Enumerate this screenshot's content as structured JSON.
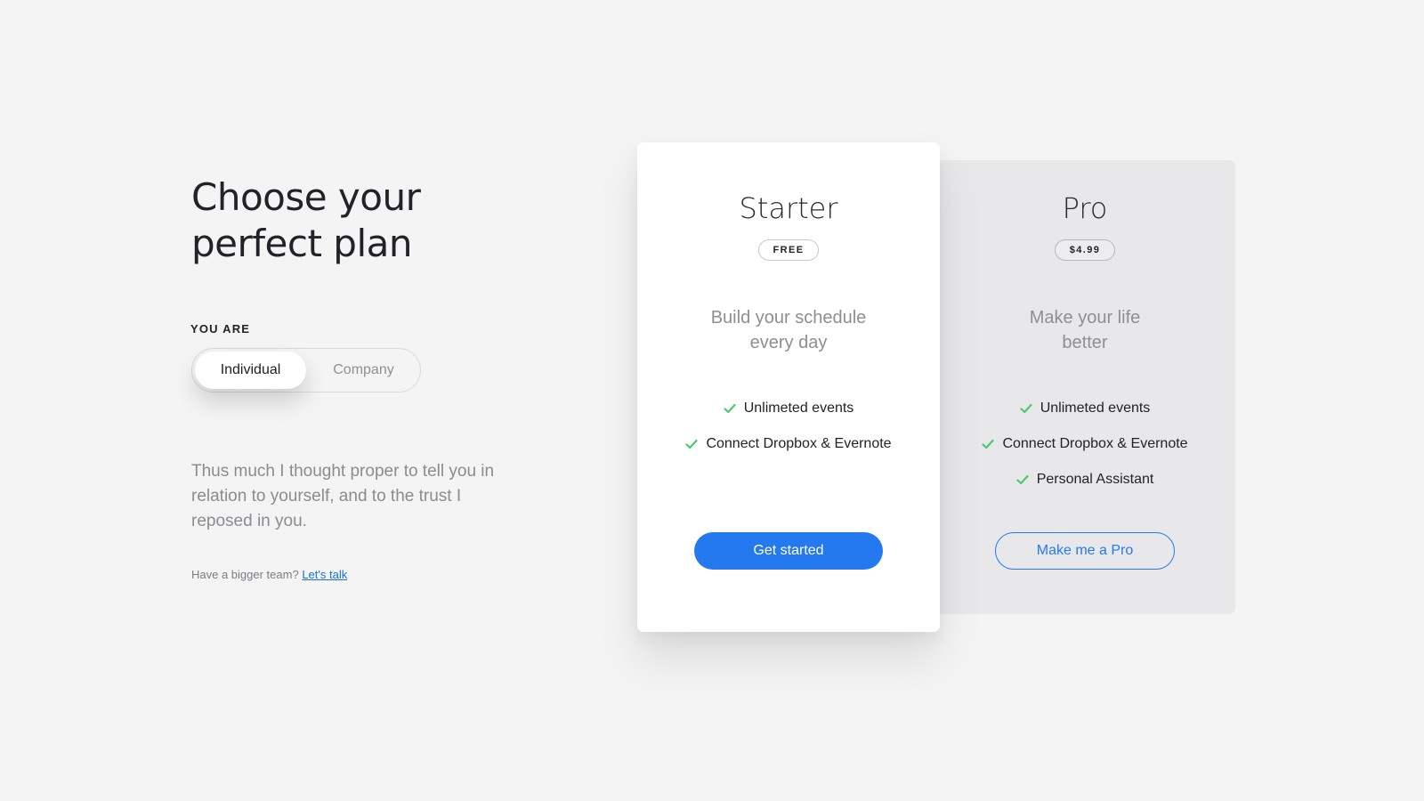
{
  "header": {
    "title_line1": "Choose your",
    "title_line2": "perfect plan"
  },
  "audience": {
    "label": "YOU ARE",
    "options": [
      {
        "label": "Individual",
        "selected": true
      },
      {
        "label": "Company",
        "selected": false
      }
    ]
  },
  "description": "Thus much I thought proper to tell you in relation to yourself, and to the trust I reposed in you.",
  "team": {
    "prompt": "Have a bigger team?",
    "link_label": "Let's talk"
  },
  "plans": [
    {
      "name": "Starter",
      "price": "FREE",
      "tagline": "Build your schedule every day",
      "features": [
        "Unlimeted events",
        "Connect Dropbox & Evernote"
      ],
      "cta": "Get started"
    },
    {
      "name": "Pro",
      "price": "$4.99",
      "tagline": "Make your life better",
      "features": [
        "Unlimeted events",
        "Connect Dropbox & Evernote",
        "Personal Assistant"
      ],
      "cta": "Make me a Pro"
    }
  ],
  "colors": {
    "accent": "#2579ef",
    "check": "#4cc96b",
    "background": "#f4f4f4"
  },
  "icons": {
    "feature": "check-icon"
  }
}
